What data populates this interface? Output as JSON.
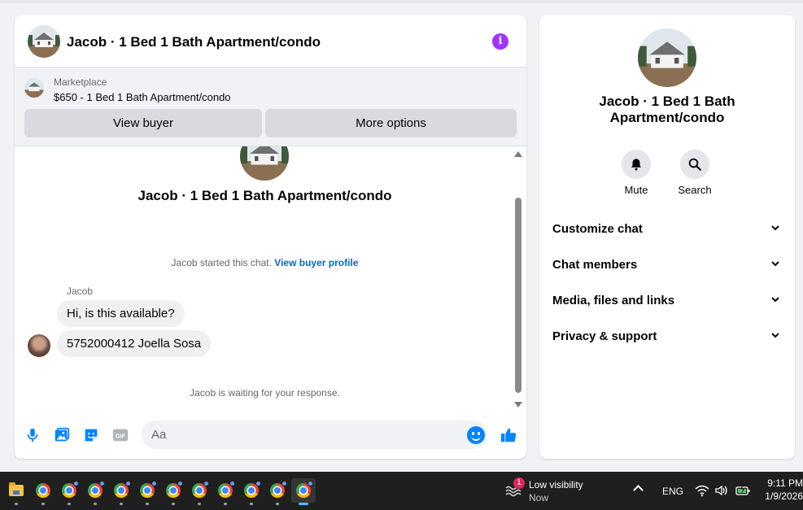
{
  "colors": {
    "accent": "#0084ff",
    "info_purple": "#a033ff",
    "link": "#0a66c2",
    "badge": "#e0245e"
  },
  "header": {
    "title": "Jacob · 1 Bed 1 Bath Apartment/condo",
    "info_icon": "i"
  },
  "marketplace": {
    "label": "Marketplace",
    "listing": "$650 - 1 Bed 1 Bath Apartment/condo",
    "view_buyer": "View buyer",
    "more_options": "More options"
  },
  "thread": {
    "title": "Jacob · 1 Bed 1 Bath Apartment/condo",
    "started_text": "Jacob started this chat.",
    "buyer_profile_link": "View buyer profile",
    "sender": "Jacob",
    "messages": [
      {
        "text": "Hi, is this available?"
      },
      {
        "text": "5752000412 Joella Sosa"
      }
    ],
    "waiting": "Jacob is waiting for your response."
  },
  "composer": {
    "placeholder": "Aa",
    "icons": [
      "microphone-icon",
      "photo-icon",
      "sticker-icon",
      "gif-icon",
      "emoji-icon",
      "thumbs-up-icon"
    ]
  },
  "info_panel": {
    "title": "Jacob · 1 Bed 1 Bath Apartment/condo",
    "actions": [
      {
        "label": "Mute",
        "icon": "bell-icon"
      },
      {
        "label": "Search",
        "icon": "search-icon"
      }
    ],
    "sections": [
      {
        "label": "Customize chat"
      },
      {
        "label": "Chat members"
      },
      {
        "label": "Media, files and links"
      },
      {
        "label": "Privacy & support"
      }
    ]
  },
  "taskbar": {
    "apps": [
      "file-explorer-icon",
      "chrome-icon",
      "chrome-icon",
      "chrome-icon",
      "chrome-icon",
      "chrome-icon",
      "chrome-icon",
      "chrome-icon",
      "chrome-icon",
      "chrome-icon",
      "chrome-icon",
      "chrome-icon"
    ],
    "weather": {
      "badge": "1",
      "title": "Low visibility",
      "subtitle": "Now"
    },
    "language": "ENG",
    "time": "9:11 PM",
    "date": "1/9/2026"
  }
}
